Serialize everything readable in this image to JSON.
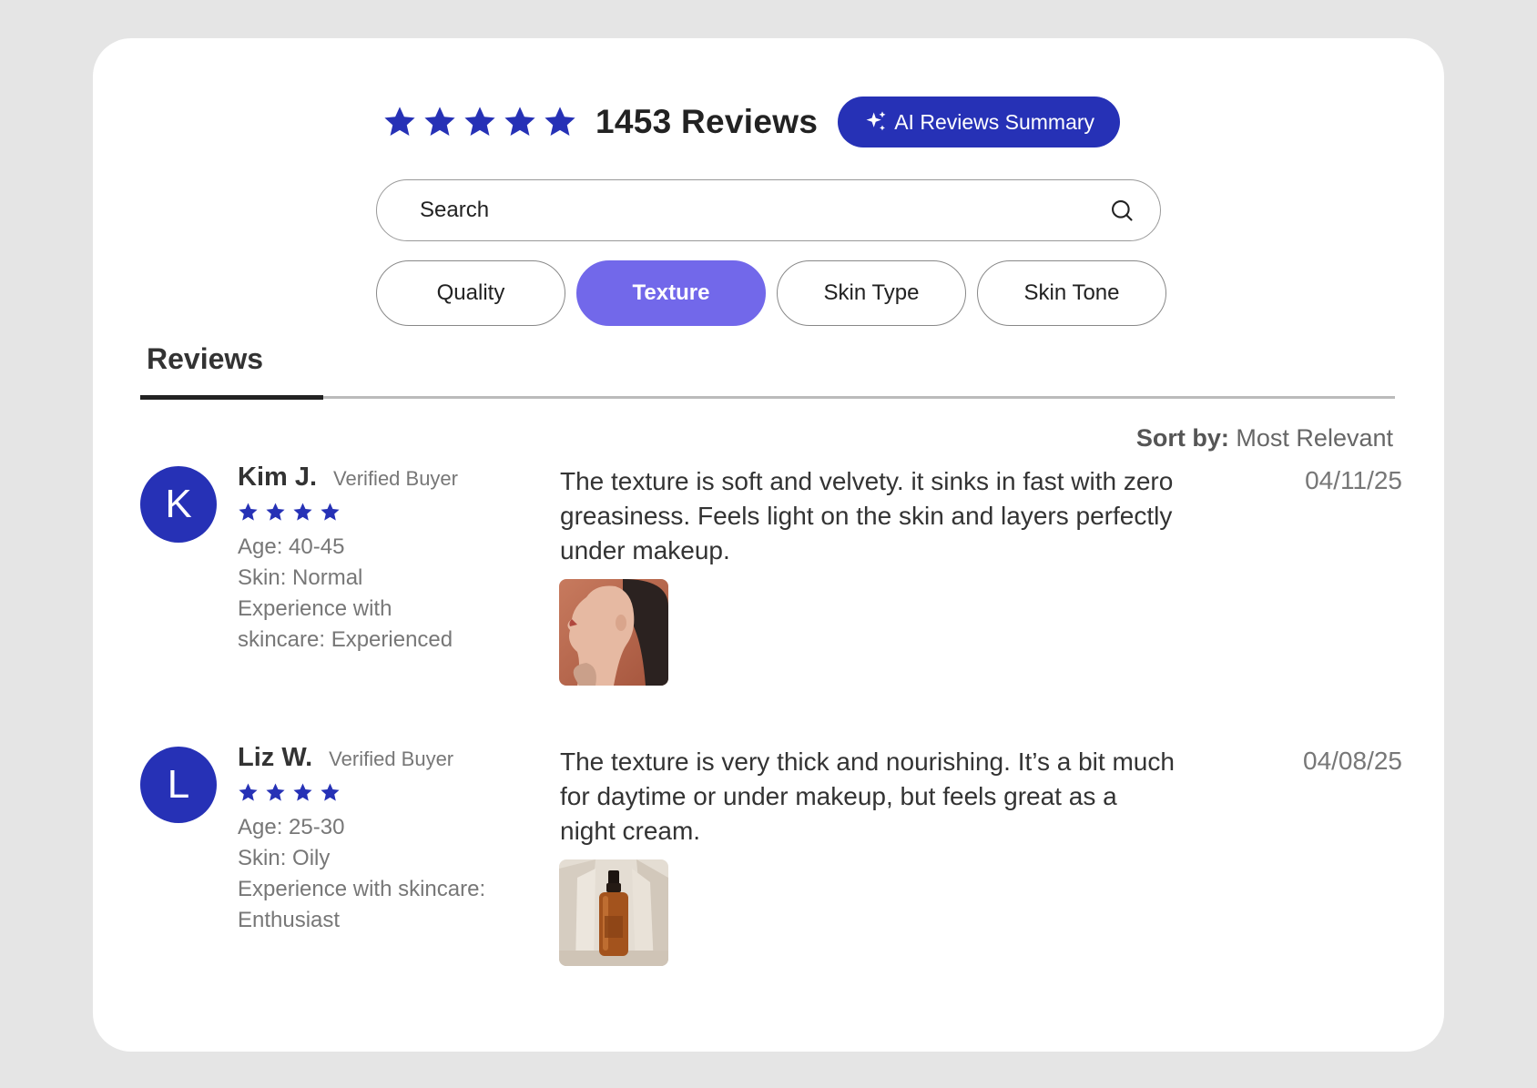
{
  "header": {
    "review_count": "1453 Reviews",
    "ai_button_label": "AI Reviews Summary",
    "overall_rating": 5
  },
  "search": {
    "placeholder": "Search"
  },
  "filters": [
    {
      "label": "Quality",
      "active": false
    },
    {
      "label": "Texture",
      "active": true
    },
    {
      "label": "Skin Type",
      "active": false
    },
    {
      "label": "Skin Tone",
      "active": false
    }
  ],
  "tabs": {
    "reviews_label": "Reviews"
  },
  "sort": {
    "label": "Sort by:",
    "value": "Most Relevant"
  },
  "reviews": [
    {
      "initial": "K",
      "name": "Kim J.",
      "badge": "Verified Buyer",
      "rating": 4,
      "age": "Age: 40-45",
      "skin": "Skin: Normal",
      "experience_line1": "Experience with",
      "experience_line2": "skincare: Experienced",
      "text": "The texture is soft and velvety. it sinks in fast with zero greasiness. Feels light on the skin and layers perfectly under makeup.",
      "date": "04/11/25",
      "image": "woman-profile-photo"
    },
    {
      "initial": "L",
      "name": "Liz W.",
      "badge": "Verified Buyer",
      "rating": 4,
      "age": "Age: 25-30",
      "skin": "Skin: Oily",
      "experience_line1": "Experience with skincare:",
      "experience_line2": "Enthusiast",
      "text": "The texture is very thick and nourishing. It’s a bit much for daytime or under makeup, but feels great as a night cream.",
      "date": "04/08/25",
      "image": "serum-bottle-photo"
    }
  ],
  "colors": {
    "accent": "#2631b6",
    "chip_active": "#7268ea",
    "background": "#e5e5e5"
  }
}
